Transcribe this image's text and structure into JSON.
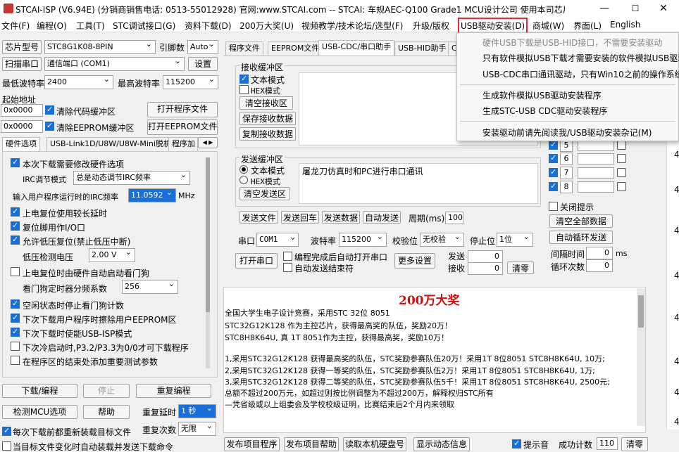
{
  "window": {
    "title": "STCAI-ISP (V6.94E) (分销商销售电话: 0513-55012928) 官网:www.STCAI.com  -- STCAI: 车规AEC-Q100 Grade1 MCU设计公司 使用本司芯片或采...",
    "min": "—",
    "max": "☐",
    "close": "✕"
  },
  "menu": [
    "文件(F)",
    "编程(O)",
    "工具(T)",
    "STC调试接口(G)",
    "资料下载(D)",
    "200万大奖(U)",
    "视频教学/技术论坛/选型(F)",
    "升级/版权",
    "USB驱动安装(D)",
    "商城(W)",
    "界面(L)",
    "English"
  ],
  "dropdown": {
    "items": [
      "硬件USB下载是USB-HID接口，不需要安装驱动",
      "只有软件模拟USB下载才需要安装的软件模拟USB驱动",
      "USB-CDC串口通讯驱动，只有Win10之前的操作系统",
      "生成软件模拟USB驱动安装程序",
      "生成STC-USB CDC驱动安装程序",
      "安装驱动前请先阅读我/USB驱动安装杂记(M)"
    ]
  },
  "left": {
    "chip_btn": "芯片型号",
    "chip_value": "STC8G1K08-8PIN",
    "pins_label": "引脚数",
    "pins_value": "Auto",
    "scan_btn": "扫描串口",
    "port_value": "通信端口 (COM1)",
    "settings_btn": "设置",
    "min_baud_label": "最低波特率",
    "min_baud": "2400",
    "max_baud_label": "最高波特率",
    "max_baud": "115200",
    "start_addr": "起始地址",
    "addr1": "0x0000",
    "clear_code": "清除代码缓冲区",
    "open_prog": "打开程序文件",
    "addr2": "0x0000",
    "clear_eeprom": "清除EEPROM缓冲区",
    "open_eeprom": "打开EEPROM文件",
    "tabs": [
      "硬件选项",
      "USB-Link1D/U8W/U8W-Mini脱机",
      "程序加"
    ],
    "opt_next_dl": "本次下载需要修改硬件选项",
    "irc_mode_label": "IRC调节模式",
    "irc_mode": "总是动态调节IRC频率",
    "irc_freq_label": "输入用户程序运行时的IRC频率",
    "irc_freq": "11.0592",
    "mhz": "MHz",
    "opts": [
      "上电复位使用较长延时",
      "复位脚用作I/O口",
      "允许低压复位(禁止低压中断)"
    ],
    "lvd_label": "低压检测电压",
    "lvd_value": "2.00 V",
    "wdt_start": "上电复位时由硬件自动启动看门狗",
    "wdt_div_label": "看门狗定时器分频系数",
    "wdt_div": "256",
    "opts2": [
      "空闲状态时停止看门狗计数",
      "下次下载用户程序时擦除用户EEPROM区",
      "下次下载时使能USB-ISP模式",
      "下次冷启动时,P3.2/P3.3为0/0才可下载程序",
      "在程序区的结束处添加重要测试参数"
    ],
    "download_btn": "下载/编程",
    "stop_btn": "停止",
    "reprog_btn": "重复编程",
    "detect_btn": "检测MCU选项",
    "help_btn": "帮助",
    "repeat_delay_label": "重复延时",
    "repeat_delay": "1 秒",
    "reload_each": "每次下载前都重新装载目标文件",
    "repeat_count_label": "重复次数",
    "repeat_count": "无限",
    "auto_reload": "当目标文件变化时自动装载并发送下载命令"
  },
  "right": {
    "tabs": [
      "程序文件",
      "EEPROM文件",
      "USB-CDC/串口助手",
      "USB-HID助手",
      "C"
    ],
    "recv_title": "接收缓冲区",
    "recv_text": "文本模式",
    "recv_hex": "HEX模式",
    "clear_recv": "清空接收区",
    "save_recv": "保存接收数据",
    "copy_recv": "复制接收数据",
    "send_title": "发送缓冲区",
    "send_text": "文本模式",
    "send_hex": "HEX模式",
    "clear_send": "清空发送区",
    "send_content": "屠龙刀仿真时和PC进行串口通讯",
    "send_file": "发送文件",
    "send_enter": "发送回车",
    "send_data": "发送数据",
    "auto_send": "自动发送",
    "period_label": "周期(ms)",
    "period": "100",
    "port_label": "串口",
    "port": "COM1",
    "baud_label": "波特率",
    "baud": "115200",
    "parity_label": "校验位",
    "parity": "无校验",
    "stop_label": "停止位",
    "stop": "1位",
    "open_port": "打开串口",
    "auto_open": "编程完成后自动打开串口",
    "auto_end": "自动发送结束符",
    "more_btn": "更多设置",
    "tx_label": "发送",
    "tx": "0",
    "rx_label": "接收",
    "rx": "0",
    "clear_btn": "清零",
    "nums": [
      "4",
      "5",
      "6",
      "7",
      "8"
    ],
    "close_tip": "关闭提示",
    "clear_all": "清空全部数据",
    "auto_loop": "自动循环发送",
    "interval_label": "间隔时间",
    "interval": "0",
    "ms": "ms",
    "loops_label": "循环次数",
    "loops": "0",
    "side_nums": [
      "4",
      "4",
      "4",
      "4",
      "4",
      "4",
      "4",
      "4"
    ]
  },
  "info": {
    "title": "200万大奖",
    "lines": [
      "全国大学生电子设计竞赛，采用STC 32位 8051",
      "STC32G12K128 作为主控芯片，获得最高奖的队伍，奖励20万！",
      "STC8H8K64U, 真 1T 8051作为主控，获得最高奖，奖励10万！",
      "",
      "1,采用STC32G12K128 获得最高奖的队伍，STC奖励参赛队伍20万！采用1T 8位8051 STC8H8K64U, 10万;",
      "2,采用STC32G12K128 获得一等奖的队伍，STC奖励参赛队伍2万！采用1T 8位8051 STC8H8K64U, 1万;",
      "3,采用STC32G12K128 获得二等奖的队伍，STC奖励参赛队伍5千！采用1T 8位8051 STC8H8K64U, 2500元;",
      "总额不超过200万元，如超过则按比例调整为不超过200万，解释权归STC所有",
      "—凭省级或以上组委会及学校校级证明，比赛结束后2个月内来领取"
    ]
  },
  "bottom": {
    "publish_prog": "发布项目程序",
    "publish_help": "发布项目帮助",
    "read_disk": "读取本机硬盘号",
    "show_info": "显示动态信息",
    "beep": "提示音",
    "success_label": "成功计数",
    "success": "110",
    "clear": "清零"
  }
}
